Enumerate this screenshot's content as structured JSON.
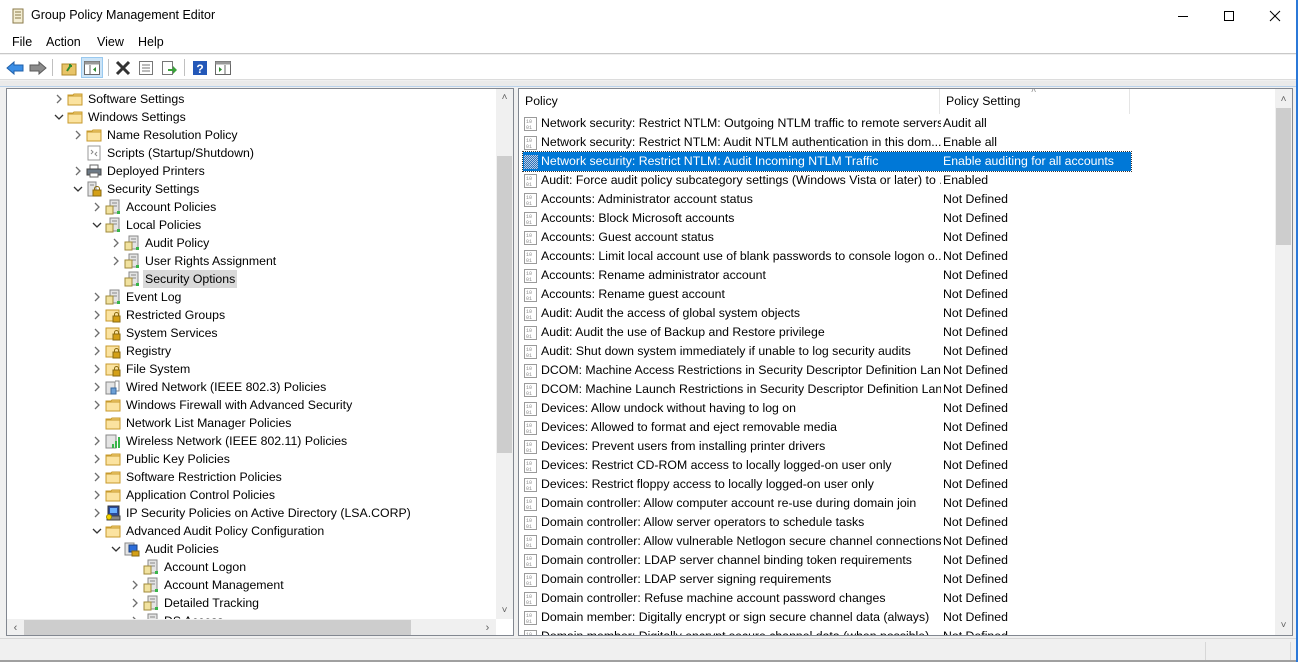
{
  "window": {
    "title": "Group Policy Management Editor",
    "controls": {
      "minimize": "minimize",
      "maximize": "maximize",
      "close": "close"
    }
  },
  "menu": [
    "File",
    "Action",
    "View",
    "Help"
  ],
  "toolbar": [
    {
      "icon": "back-arrow-icon",
      "label": "Back"
    },
    {
      "icon": "forward-arrow-icon",
      "label": "Forward"
    },
    {
      "icon": "up-folder-icon",
      "label": "Up one level"
    },
    {
      "icon": "show-hide-console-tree-icon",
      "label": "Show/Hide Console Tree",
      "pressed": true
    },
    {
      "icon": "delete-icon",
      "label": "Delete"
    },
    {
      "icon": "properties-icon",
      "label": "Properties"
    },
    {
      "icon": "export-list-icon",
      "label": "Export List"
    },
    {
      "icon": "help-icon",
      "label": "Help"
    },
    {
      "icon": "show-hide-action-pane-icon",
      "label": "Show/Hide Action Pane"
    }
  ],
  "tree": [
    {
      "label": "Software Settings",
      "level": 0,
      "expander": "collapsed",
      "icon": "folder"
    },
    {
      "label": "Windows Settings",
      "level": 0,
      "expander": "expanded",
      "icon": "folder"
    },
    {
      "label": "Name Resolution Policy",
      "level": 1,
      "expander": "collapsed",
      "icon": "folder"
    },
    {
      "label": "Scripts (Startup/Shutdown)",
      "level": 1,
      "expander": "none",
      "icon": "script"
    },
    {
      "label": "Deployed Printers",
      "level": 1,
      "expander": "collapsed",
      "icon": "printer"
    },
    {
      "label": "Security Settings",
      "level": 1,
      "expander": "expanded",
      "icon": "security"
    },
    {
      "label": "Account Policies",
      "level": 2,
      "expander": "collapsed",
      "icon": "policy"
    },
    {
      "label": "Local Policies",
      "level": 2,
      "expander": "expanded",
      "icon": "policy"
    },
    {
      "label": "Audit Policy",
      "level": 3,
      "expander": "collapsed",
      "icon": "policy"
    },
    {
      "label": "User Rights Assignment",
      "level": 3,
      "expander": "collapsed",
      "icon": "policy"
    },
    {
      "label": "Security Options",
      "level": 3,
      "expander": "none",
      "icon": "policy",
      "selected": true
    },
    {
      "label": "Event Log",
      "level": 2,
      "expander": "collapsed",
      "icon": "policy"
    },
    {
      "label": "Restricted Groups",
      "level": 2,
      "expander": "collapsed",
      "icon": "lock-folder"
    },
    {
      "label": "System Services",
      "level": 2,
      "expander": "collapsed",
      "icon": "lock-folder"
    },
    {
      "label": "Registry",
      "level": 2,
      "expander": "collapsed",
      "icon": "lock-folder"
    },
    {
      "label": "File System",
      "level": 2,
      "expander": "collapsed",
      "icon": "lock-folder"
    },
    {
      "label": "Wired Network (IEEE 802.3) Policies",
      "level": 2,
      "expander": "collapsed",
      "icon": "wired"
    },
    {
      "label": "Windows Firewall with Advanced Security",
      "level": 2,
      "expander": "collapsed",
      "icon": "folder"
    },
    {
      "label": "Network List Manager Policies",
      "level": 2,
      "expander": "none",
      "icon": "folder"
    },
    {
      "label": "Wireless Network (IEEE 802.11) Policies",
      "level": 2,
      "expander": "collapsed",
      "icon": "wireless"
    },
    {
      "label": "Public Key Policies",
      "level": 2,
      "expander": "collapsed",
      "icon": "folder"
    },
    {
      "label": "Software Restriction Policies",
      "level": 2,
      "expander": "collapsed",
      "icon": "folder"
    },
    {
      "label": "Application Control Policies",
      "level": 2,
      "expander": "collapsed",
      "icon": "folder"
    },
    {
      "label": "IP Security Policies on Active Directory (LSA.CORP)",
      "level": 2,
      "expander": "collapsed",
      "icon": "ipsec"
    },
    {
      "label": "Advanced Audit Policy Configuration",
      "level": 2,
      "expander": "expanded",
      "icon": "folder"
    },
    {
      "label": "Audit Policies",
      "level": 3,
      "expander": "expanded",
      "icon": "audit"
    },
    {
      "label": "Account Logon",
      "level": 4,
      "expander": "none",
      "icon": "policy"
    },
    {
      "label": "Account Management",
      "level": 4,
      "expander": "collapsed",
      "icon": "policy"
    },
    {
      "label": "Detailed Tracking",
      "level": 4,
      "expander": "collapsed",
      "icon": "policy"
    },
    {
      "label": "DS Access",
      "level": 4,
      "expander": "collapsed",
      "icon": "policy"
    }
  ],
  "list": {
    "columns": [
      "Policy",
      "Policy Setting"
    ],
    "sorted_column": "Policy Setting",
    "rows": [
      {
        "policy": "Network security: Restrict NTLM: Outgoing NTLM traffic to remote servers",
        "setting": "Audit all"
      },
      {
        "policy": "Network security: Restrict NTLM: Audit NTLM authentication in this dom...",
        "setting": "Enable all"
      },
      {
        "policy": "Network security: Restrict NTLM: Audit Incoming NTLM Traffic",
        "setting": "Enable auditing for all accounts",
        "selected": true
      },
      {
        "policy": "Audit: Force audit policy subcategory settings (Windows Vista or later) to ...",
        "setting": "Enabled"
      },
      {
        "policy": "Accounts: Administrator account status",
        "setting": "Not Defined"
      },
      {
        "policy": "Accounts: Block Microsoft accounts",
        "setting": "Not Defined"
      },
      {
        "policy": "Accounts: Guest account status",
        "setting": "Not Defined"
      },
      {
        "policy": "Accounts: Limit local account use of blank passwords to console logon o...",
        "setting": "Not Defined"
      },
      {
        "policy": "Accounts: Rename administrator account",
        "setting": "Not Defined"
      },
      {
        "policy": "Accounts: Rename guest account",
        "setting": "Not Defined"
      },
      {
        "policy": "Audit: Audit the access of global system objects",
        "setting": "Not Defined"
      },
      {
        "policy": "Audit: Audit the use of Backup and Restore privilege",
        "setting": "Not Defined"
      },
      {
        "policy": "Audit: Shut down system immediately if unable to log security audits",
        "setting": "Not Defined"
      },
      {
        "policy": "DCOM: Machine Access Restrictions in Security Descriptor Definition Lan...",
        "setting": "Not Defined"
      },
      {
        "policy": "DCOM: Machine Launch Restrictions in Security Descriptor Definition Lan...",
        "setting": "Not Defined"
      },
      {
        "policy": "Devices: Allow undock without having to log on",
        "setting": "Not Defined"
      },
      {
        "policy": "Devices: Allowed to format and eject removable media",
        "setting": "Not Defined"
      },
      {
        "policy": "Devices: Prevent users from installing printer drivers",
        "setting": "Not Defined"
      },
      {
        "policy": "Devices: Restrict CD-ROM access to locally logged-on user only",
        "setting": "Not Defined"
      },
      {
        "policy": "Devices: Restrict floppy access to locally logged-on user only",
        "setting": "Not Defined"
      },
      {
        "policy": "Domain controller: Allow computer account re-use during domain join",
        "setting": "Not Defined"
      },
      {
        "policy": "Domain controller: Allow server operators to schedule tasks",
        "setting": "Not Defined"
      },
      {
        "policy": "Domain controller: Allow vulnerable Netlogon secure channel connections",
        "setting": "Not Defined"
      },
      {
        "policy": "Domain controller: LDAP server channel binding token requirements",
        "setting": "Not Defined"
      },
      {
        "policy": "Domain controller: LDAP server signing requirements",
        "setting": "Not Defined"
      },
      {
        "policy": "Domain controller: Refuse machine account password changes",
        "setting": "Not Defined"
      },
      {
        "policy": "Domain member: Digitally encrypt or sign secure channel data (always)",
        "setting": "Not Defined"
      },
      {
        "policy": "Domain member: Digitally encrypt secure channel data (when possible)",
        "setting": "Not Defined"
      }
    ]
  },
  "colors": {
    "selection": "#0078d7",
    "tree_selection": "#d9d9d9",
    "window_border": "#2b78d8"
  },
  "scroll": {
    "tree_vertical_fraction_visible": 0.6,
    "tree_horizontal_fraction_visible": 0.85,
    "list_vertical_fraction_visible": 0.27
  }
}
